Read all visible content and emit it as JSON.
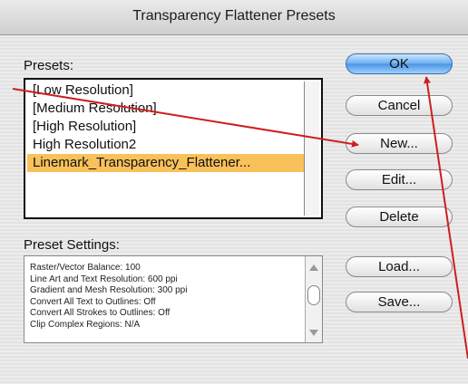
{
  "window": {
    "title": "Transparency Flattener Presets"
  },
  "presets": {
    "label": "Presets:",
    "items": [
      {
        "label": "[Low Resolution]",
        "selected": false
      },
      {
        "label": "[Medium Resolution]",
        "selected": false
      },
      {
        "label": "[High Resolution]",
        "selected": false
      },
      {
        "label": "High Resolution2",
        "selected": false
      },
      {
        "label": "Linemark_Transparency_Flattener...",
        "selected": true
      }
    ]
  },
  "settings": {
    "label": "Preset Settings:",
    "lines": [
      "Raster/Vector Balance: 100",
      "Line Art and Text Resolution: 600 ppi",
      "Gradient and Mesh Resolution: 300 ppi",
      "Convert All Text to Outlines: Off",
      "Convert All Strokes to Outlines: Off",
      "Clip Complex Regions: N/A"
    ]
  },
  "buttons": {
    "ok": "OK",
    "cancel": "Cancel",
    "new": "New...",
    "edit": "Edit...",
    "delete": "Delete",
    "load": "Load...",
    "save": "Save..."
  },
  "colors": {
    "selection": "#f9c15a",
    "annotation_arrow": "#cc1f1f",
    "default_button": "#4a93e5"
  }
}
